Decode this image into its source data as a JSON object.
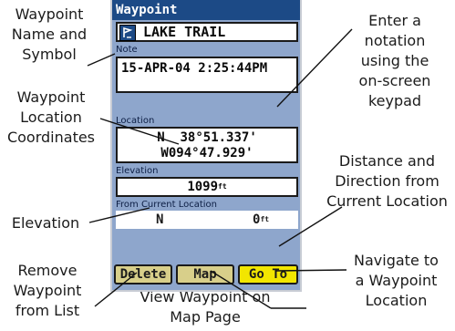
{
  "callouts": {
    "name_symbol": "Waypoint\nName and\nSymbol",
    "coordinates": "Waypoint\nLocation\nCoordinates",
    "elevation": "Elevation",
    "remove": "Remove\nWaypoint\nfrom List",
    "view_map": "View Waypoint on\nMap Page",
    "navigate": "Navigate to\na Waypoint\nLocation",
    "distance_direction": "Distance and\nDirection from\nCurrent Location",
    "notation": "Enter a\nnotation\nusing the\non-screen\nkeypad"
  },
  "screen": {
    "title": "Waypoint",
    "name": "LAKE TRAIL",
    "symbol_icon": "waypoint-flag-icon",
    "note_label": "Note",
    "note_value": "15-APR-04 2:25:44PM",
    "location_label": "Location",
    "lat": "N  38°51.337'",
    "lon": "W094°47.929'",
    "elevation_label": "Elevation",
    "elevation_value": "1099",
    "elevation_unit": "ft",
    "from_current_label": "From Current Location",
    "direction": "N",
    "distance": "0",
    "distance_unit": "ft"
  },
  "buttons": {
    "delete": "Delete",
    "map": "Map",
    "goto": "Go To"
  },
  "colors": {
    "titlebar": "#1c4a86",
    "panel": "#8ea6cc",
    "button_default": "#d8cf8a",
    "button_selected": "#f2e600"
  }
}
